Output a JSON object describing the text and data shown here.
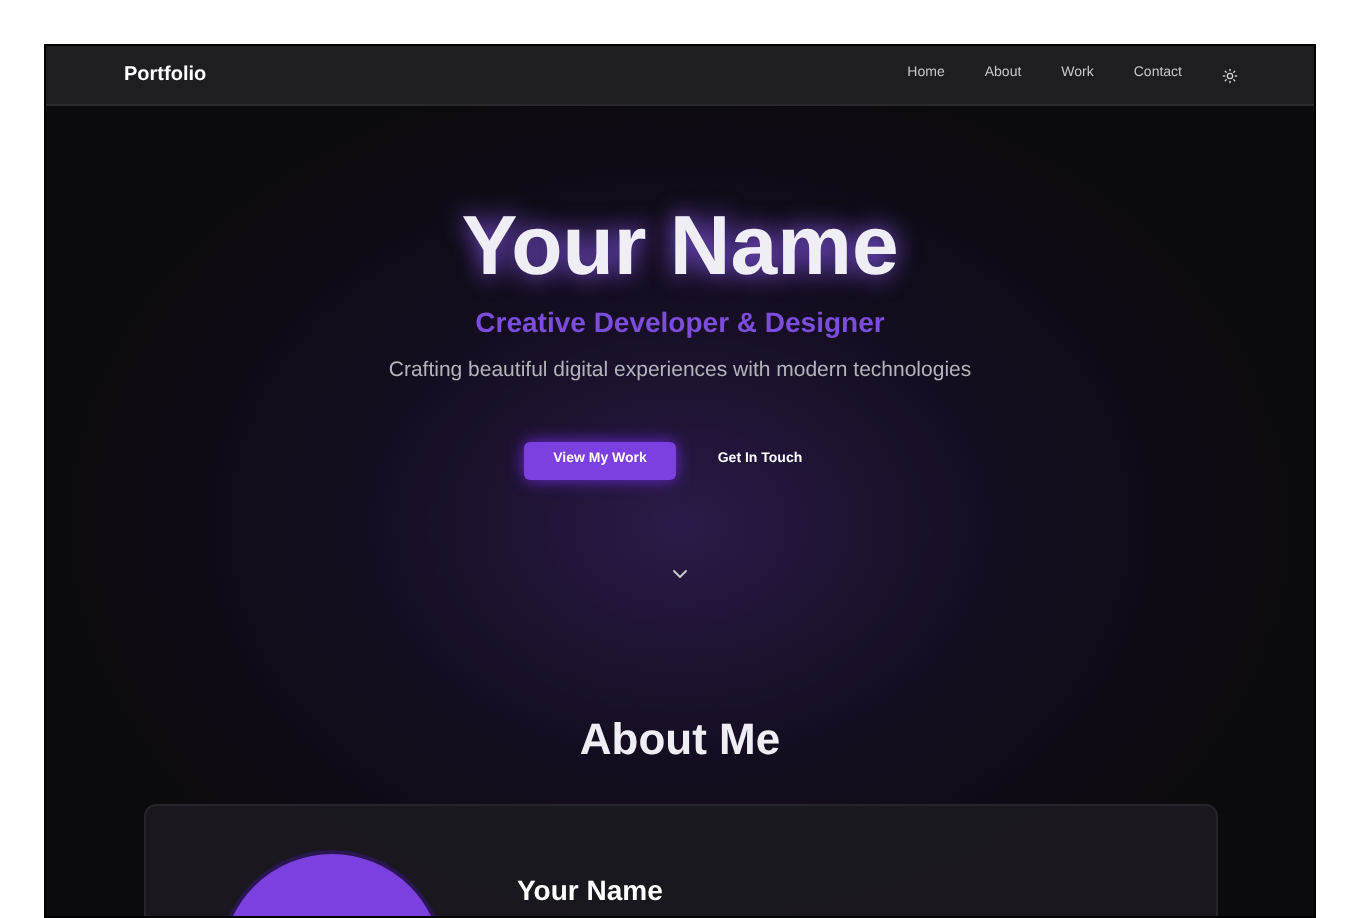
{
  "nav": {
    "brand": "Portfolio",
    "links": [
      "Home",
      "About",
      "Work",
      "Contact"
    ]
  },
  "hero": {
    "name": "Your Name",
    "subtitle": "Creative Developer & Designer",
    "tagline": "Crafting beautiful digital experiences with modern technologies",
    "buttons": [
      {
        "label": "View My Work",
        "kind": "primary"
      },
      {
        "label": "Get In Touch",
        "kind": "ghost"
      }
    ]
  },
  "about": {
    "heading": "About Me",
    "card_name": "Your Name"
  }
}
